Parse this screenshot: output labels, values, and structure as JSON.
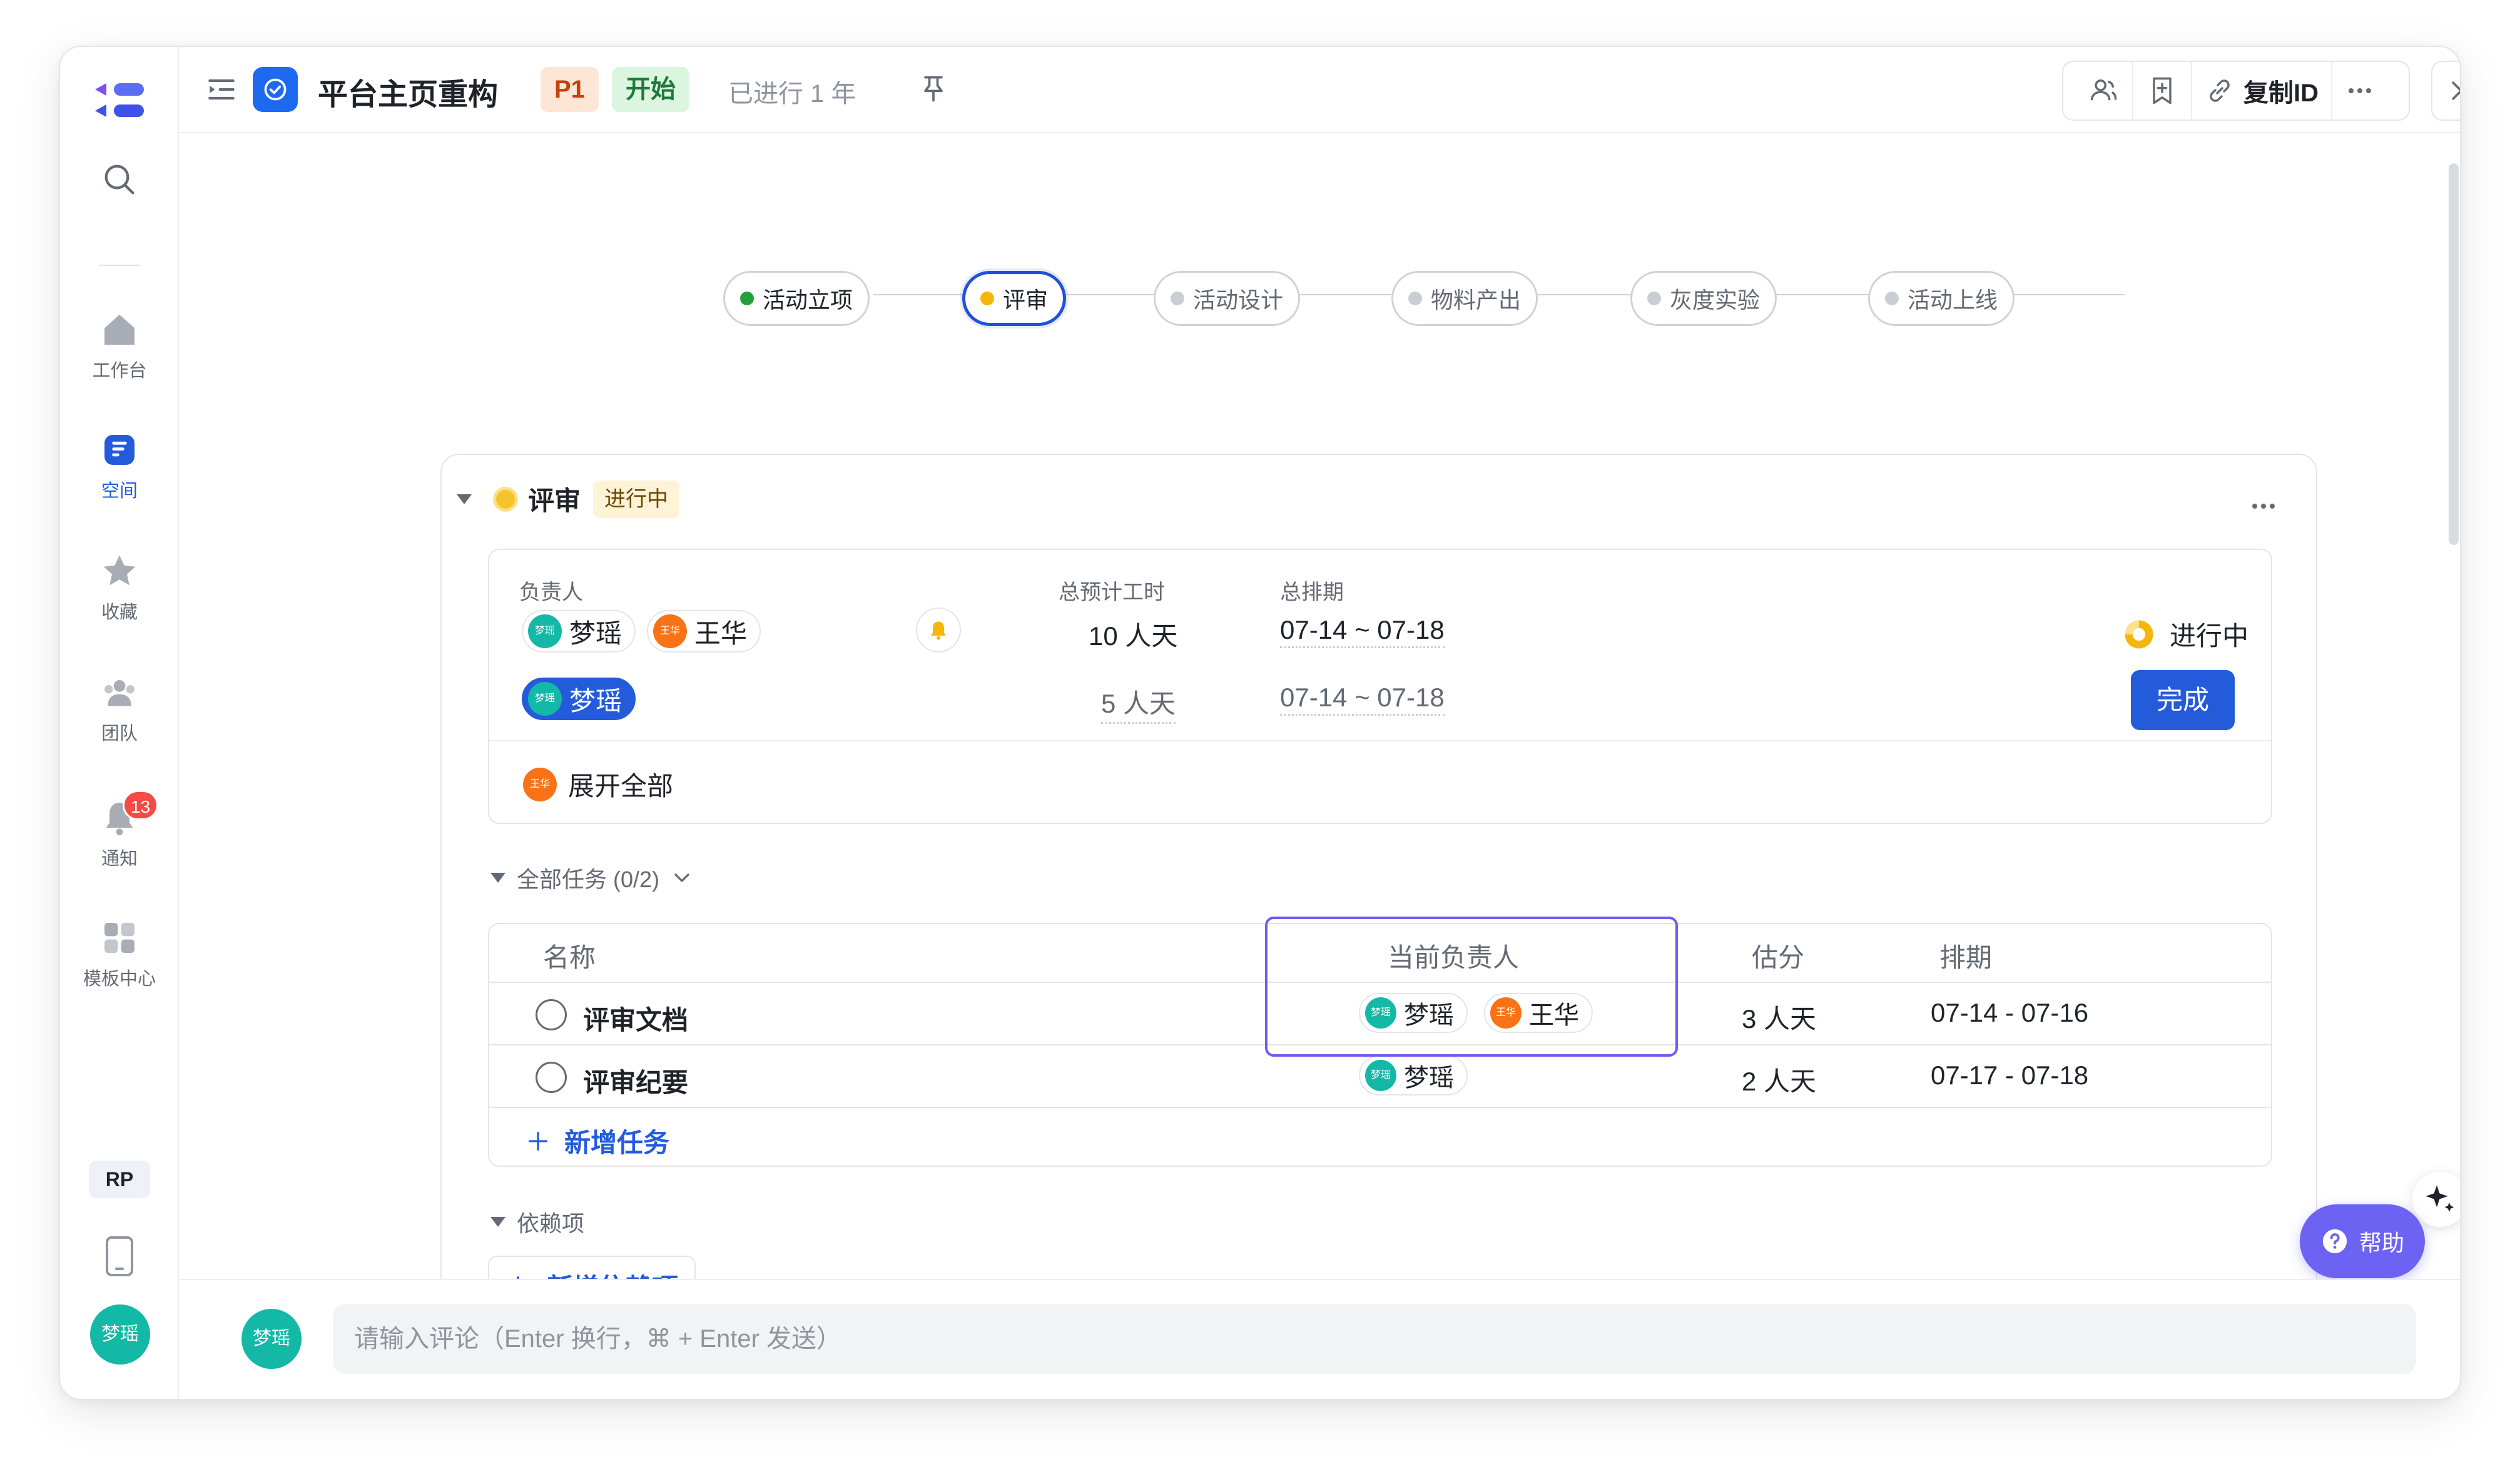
{
  "rail": {
    "items": [
      {
        "label": "工作台",
        "icon": "home-icon"
      },
      {
        "label": "空间",
        "icon": "space-icon"
      },
      {
        "label": "收藏",
        "icon": "star-icon"
      },
      {
        "label": "团队",
        "icon": "team-icon"
      },
      {
        "label": "通知",
        "icon": "bell-icon",
        "badge": "13"
      },
      {
        "label": "模板中心",
        "icon": "template-icon"
      }
    ],
    "rp_label": "RP",
    "user_avatar": "梦瑶"
  },
  "header": {
    "title": "平台主页重构",
    "priority": "P1",
    "status": "开始",
    "elapsed": "已进行 1 年",
    "copy_id": "复制ID"
  },
  "stages": [
    {
      "label": "活动立项",
      "state": "done"
    },
    {
      "label": "评审",
      "state": "current"
    },
    {
      "label": "活动设计",
      "state": "todo"
    },
    {
      "label": "物料产出",
      "state": "todo"
    },
    {
      "label": "灰度实验",
      "state": "todo"
    },
    {
      "label": "活动上线",
      "state": "todo"
    }
  ],
  "stage": {
    "name": "评审",
    "status": "进行中",
    "assign": {
      "headers": {
        "owner": "负责人",
        "effort": "总预计工时",
        "schedule": "总排期"
      },
      "row1": {
        "owners": [
          "梦瑶",
          "王华"
        ],
        "effort": "10 人天",
        "schedule": "07-14 ~ 07-18",
        "status": "进行中"
      },
      "row2": {
        "owner": "梦瑶",
        "effort": "5 人天",
        "schedule": "07-14 ~ 07-18",
        "action": "完成"
      },
      "expand_all": "展开全部",
      "expand_avatar": "王华"
    },
    "tasks": {
      "section": "全部任务 (0/2)",
      "headers": {
        "name": "名称",
        "assignee": "当前负责人",
        "estimate": "估分",
        "schedule": "排期"
      },
      "rows": [
        {
          "name": "评审文档",
          "assignees": [
            "梦瑶",
            "王华"
          ],
          "estimate": "3 人天",
          "schedule": "07-14 - 07-16"
        },
        {
          "name": "评审纪要",
          "assignees": [
            "梦瑶"
          ],
          "estimate": "2 人天",
          "schedule": "07-17 - 07-18"
        }
      ],
      "add": "新增任务"
    },
    "deps": {
      "section": "依赖项",
      "add": "新增依赖项"
    }
  },
  "help": "帮助",
  "comment": {
    "avatar": "梦瑶",
    "placeholder": "请输入评论（Enter 换行，⌘ + Enter 发送）"
  },
  "colors": {
    "accent": "#245bdb",
    "done": "#22a03c",
    "current": "#f5b60a",
    "help": "#6d63f2"
  }
}
